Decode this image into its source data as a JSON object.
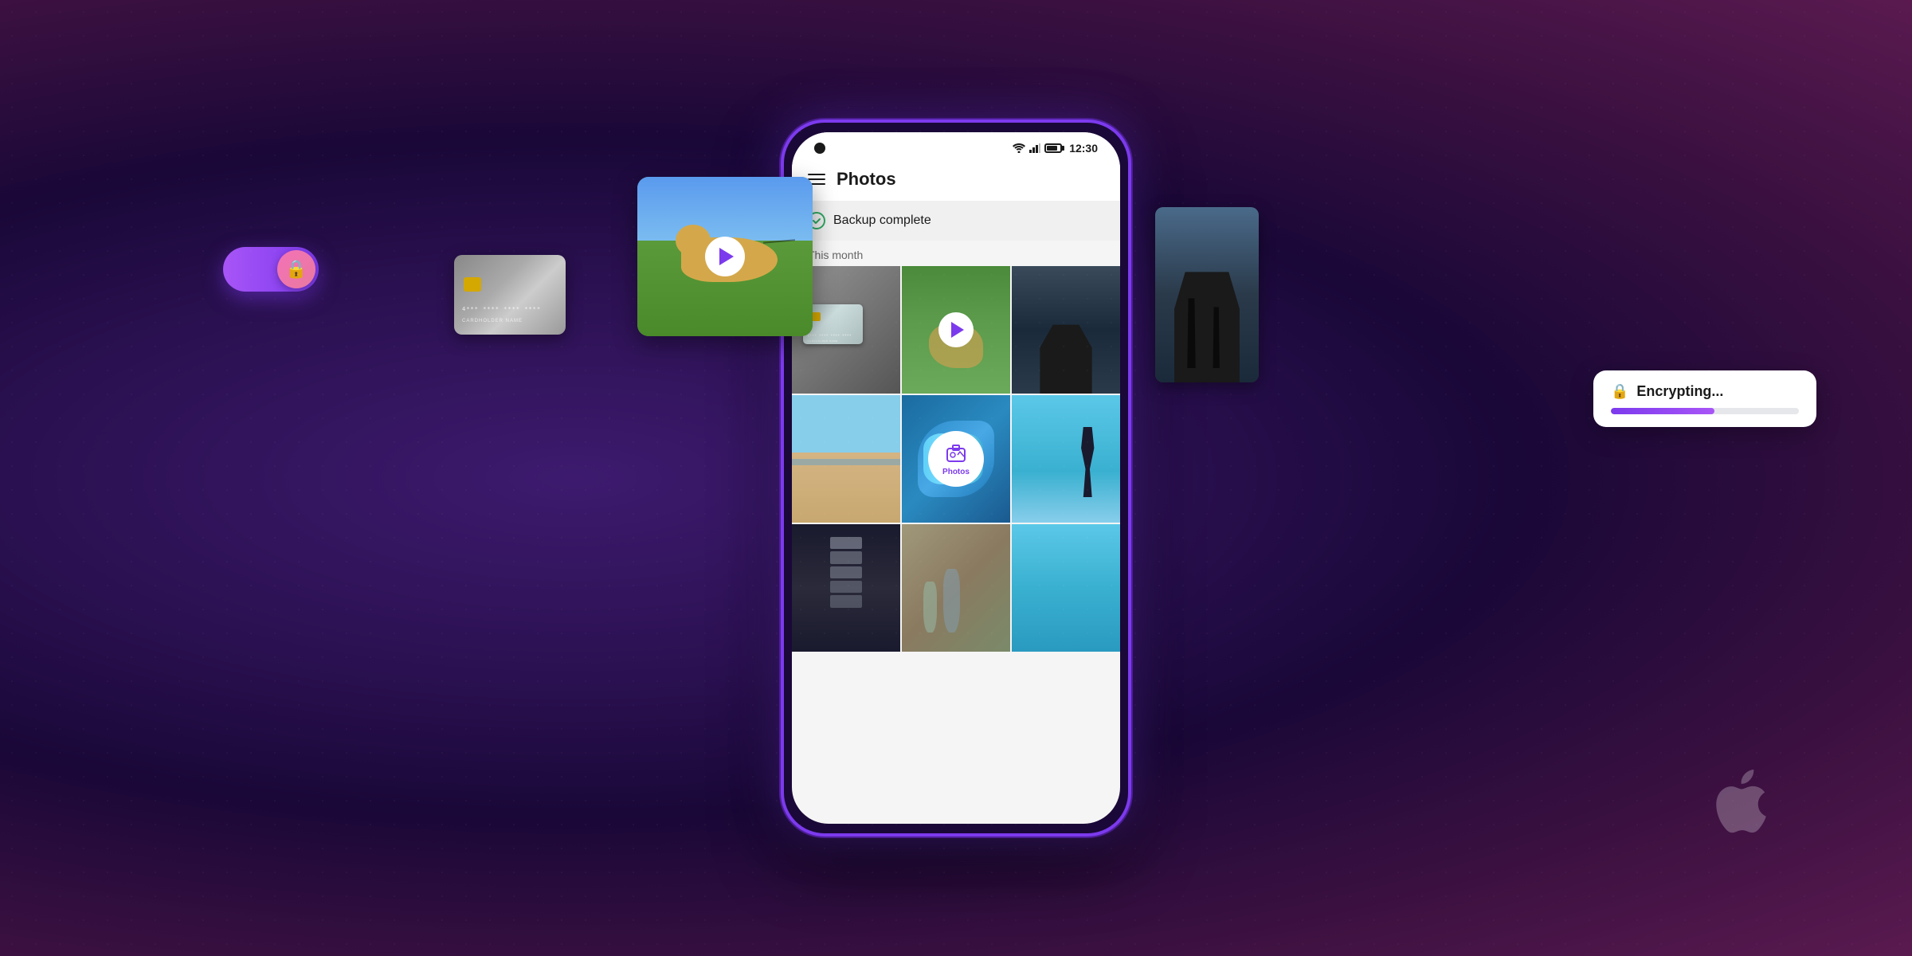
{
  "background": {
    "gradient_start": "#3d1a6e",
    "gradient_end": "#5a1a50"
  },
  "phone": {
    "border_color": "#7c3aed",
    "screen_bg": "#f5f5f5"
  },
  "status_bar": {
    "time": "12:30",
    "camera_dot": true
  },
  "app_header": {
    "title": "Photos",
    "menu_icon": "hamburger-icon"
  },
  "backup_banner": {
    "text": "Backup complete",
    "icon": "check-circle-icon",
    "icon_color": "#2da862"
  },
  "section": {
    "label": "This month"
  },
  "photo_grid": {
    "cells": [
      {
        "id": 1,
        "style": "pg1",
        "type": "card"
      },
      {
        "id": 2,
        "style": "pg2",
        "type": "video"
      },
      {
        "id": 3,
        "style": "pg3",
        "type": "arch"
      },
      {
        "id": 4,
        "style": "pg4",
        "type": "beach"
      },
      {
        "id": 5,
        "style": "pg5",
        "type": "fish",
        "has_overlay": true
      },
      {
        "id": 6,
        "style": "pg6",
        "type": "woman"
      },
      {
        "id": 7,
        "style": "pg7",
        "type": "xray"
      },
      {
        "id": 8,
        "style": "pg8",
        "type": "room"
      },
      {
        "id": 9,
        "style": "pg9",
        "type": "water"
      }
    ]
  },
  "lock_toggle": {
    "active": true,
    "bg_gradient": "linear-gradient(90deg, #a855f7, #7c3aed)",
    "knob_icon": "🔒"
  },
  "encrypting_toast": {
    "icon": "🔒",
    "text": "Encrypting...",
    "progress_percent": 55,
    "progress_color": "#7c3aed"
  },
  "photos_app_icon": {
    "label": "Photos",
    "color": "#7c3aed"
  },
  "dog_video": {
    "description": "dog running on grass"
  },
  "credit_card": {
    "number": "4*** **** **** ****",
    "holder": "CARDHOLDER NAME"
  }
}
